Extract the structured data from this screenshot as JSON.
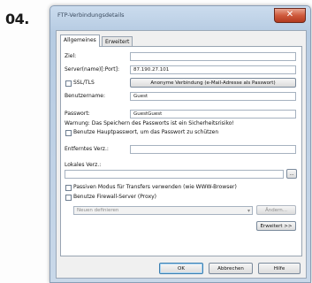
{
  "step_label": "04.",
  "window": {
    "title": "FTP-Verbindungsdetails",
    "close_glyph": "✕"
  },
  "tabs": [
    {
      "label": "Allgemeines"
    },
    {
      "label": "Erweitert"
    }
  ],
  "form": {
    "ziel_label": "Ziel:",
    "ziel_value": "",
    "server_label": "Server(name)[:Port]:",
    "server_value": "87.190.27.101",
    "ssl_label": "SSL/TLS",
    "anon_button": "Anonyme Verbindung (e-Mail-Adresse als Passwort)",
    "user_label": "Benutzername:",
    "user_value": "Guest",
    "pass_label": "Passwort:",
    "pass_value": "GuestGuest",
    "warning": "Warnung: Das Speichern des Passworts ist ein Sicherheitsrisiko!",
    "master_pw_label": "Benutze Hauptpasswort, um das Passwort zu schützen",
    "remote_dir_label": "Entferntes Verz.:",
    "remote_dir_value": "",
    "local_dir_label": "Lokales Verz.:",
    "local_dir_value": "",
    "browse_button": "...",
    "passive_label": "Passiven Modus für Transfers verwenden (wie WWW-Browser)",
    "firewall_label": "Benutze Firewall-Server (Proxy)",
    "proxy_select": "Neuen definieren",
    "proxy_edit_button": "Ändern...",
    "advanced_button": "Erweitert >>"
  },
  "footer": {
    "ok": "OK",
    "cancel": "Abbrechen",
    "help": "Hilfe"
  }
}
